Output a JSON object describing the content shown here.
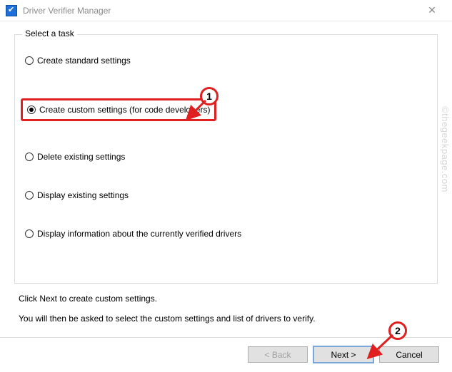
{
  "window": {
    "title": "Driver Verifier Manager",
    "close_glyph": "✕"
  },
  "group": {
    "legend": "Select a task",
    "options": {
      "standard": "Create standard settings",
      "custom": "Create custom settings (for code developers)",
      "delete": "Delete existing settings",
      "display": "Display existing settings",
      "displayinfo": "Display information about the currently verified drivers"
    }
  },
  "info": {
    "line1": "Click Next to create custom settings.",
    "line2": "You will then be asked to select the custom settings and list of drivers to verify."
  },
  "buttons": {
    "back": "< Back",
    "next": "Next >",
    "cancel": "Cancel"
  },
  "annotations": {
    "one": "1",
    "two": "2"
  },
  "watermark": "©thegeekpage.com"
}
